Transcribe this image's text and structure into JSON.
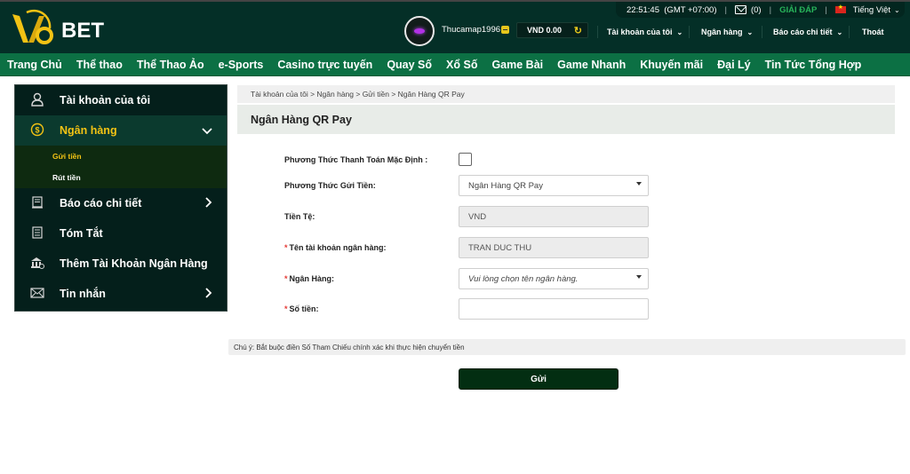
{
  "header": {
    "logo_text": "BET",
    "logo_mark": "V9",
    "time": "22:51:45",
    "timezone": "(GMT +07:00)",
    "messages_count": "(0)",
    "help_label": "GIẢI ĐÁP",
    "language": "Tiếng Việt",
    "username": "Thucamap1996",
    "balance": "VND 0.00",
    "nav_top": [
      "Tài khoản của tôi",
      "Ngân hàng",
      "Báo cáo chi tiết"
    ],
    "logout_label": "Thoát"
  },
  "main_nav": [
    "Trang Chủ",
    "Thể thao",
    "Thể Thao Ảo",
    "e-Sports",
    "Casino trực tuyến",
    "Quay Số",
    "Xổ Số",
    "Game Bài",
    "Game Nhanh",
    "Khuyến mãi",
    "Đại Lý",
    "Tin Tức Tổng Hợp"
  ],
  "sidebar": {
    "items": [
      {
        "label": "Tài khoản của tôi",
        "icon": "user-icon"
      },
      {
        "label": "Ngân hàng",
        "icon": "dollar-circle-icon",
        "active": true
      },
      {
        "label": "Báo cáo chi tiết",
        "icon": "report-icon"
      },
      {
        "label": "Tóm Tắt",
        "icon": "summary-icon"
      },
      {
        "label": "Thêm Tài Khoản Ngân Hàng",
        "icon": "bank-icon"
      },
      {
        "label": "Tin nhắn",
        "icon": "mail-icon"
      }
    ],
    "subitems": [
      {
        "label": "Gửi tiền",
        "current": true
      },
      {
        "label": "Rút tiền"
      }
    ]
  },
  "content": {
    "breadcrumb": "Tài khoản của tôi > Ngân hàng > Gửi tiền > Ngân Hàng QR Pay",
    "title": "Ngân Hàng QR Pay",
    "form": {
      "default_method_label": "Phương Thức Thanh Toán Mặc Định :",
      "default_method_checked": false,
      "deposit_method_label": "Phương Thức Gửi Tiền:",
      "deposit_method_value": "Ngân Hàng QR Pay",
      "currency_label": "Tiền Tệ:",
      "currency_value": "VND",
      "account_name_label": "Tên tài khoản ngân hàng:",
      "account_name_value": "TRAN DUC THU",
      "bank_label": "Ngân Hàng:",
      "bank_placeholder": "Vui lòng chọn tên ngân hàng.",
      "amount_label": "Số tiền:",
      "amount_value": "",
      "required_mark": "*"
    },
    "note": "Chú ý: Bắt buộc điền Số Tham Chiếu chính xác khi thực hiện chuyển tiền",
    "submit_label": "Gửi"
  },
  "colors": {
    "header_bg": "#042f27",
    "nav_bg": "#0c7044",
    "accent_yellow": "#f3c314",
    "help_green": "#27b35a",
    "submit_bg": "#032e12"
  }
}
